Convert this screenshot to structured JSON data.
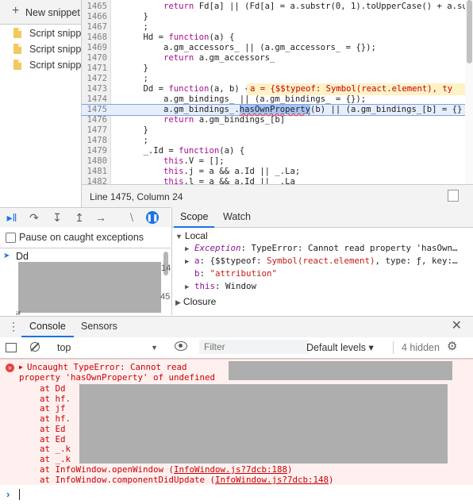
{
  "sources_sidebar": {
    "new_snippet_label": "New snippet",
    "snippets": [
      "Script snipp",
      "Script snipp",
      "Script snipp"
    ]
  },
  "editor": {
    "lines": [
      {
        "num": "1465",
        "code": "        return Fd[a] || (Fd[a] = a.substr(0, 1).toUpperCase() + a.su"
      },
      {
        "num": "1466",
        "code": "    }"
      },
      {
        "num": "1467",
        "code": "    ;"
      },
      {
        "num": "1468",
        "code": "    Hd = function(a) {"
      },
      {
        "num": "1469",
        "code": "        a.gm_accessors_ || (a.gm_accessors_ = {});"
      },
      {
        "num": "1470",
        "code": "        return a.gm_accessors_"
      },
      {
        "num": "1471",
        "code": "    }"
      },
      {
        "num": "1472",
        "code": "    ;"
      },
      {
        "num": "1473",
        "code": "    Dd = function(a, b) {"
      },
      {
        "num": "1474",
        "code": "        a.gm_bindings_ || (a.gm_bindings_ = {});"
      },
      {
        "num": "1475",
        "code": "        a.gm_bindings_.hasOwnProperty(b) || (a.gm_bindings_[b] = {}"
      },
      {
        "num": "1476",
        "code": "        return a.gm_bindings_[b]"
      },
      {
        "num": "1477",
        "code": "    }"
      },
      {
        "num": "1478",
        "code": "    ;"
      },
      {
        "num": "1479",
        "code": "    _.Id = function(a) {"
      },
      {
        "num": "1480",
        "code": "        this.V = [];"
      },
      {
        "num": "1481",
        "code": "        this.j = a && a.Id || _.La;"
      },
      {
        "num": "1482",
        "code": "        this.l = a && a.Id || _.La"
      }
    ],
    "inline_tooltip": "a = {$$typeof: Symbol(react.element), ty",
    "status": "Line 1475, Column 24"
  },
  "debugger": {
    "pause_on_caught_label": "Pause on caught exceptions",
    "call_stack_first": "Dd",
    "call_stack_num_1": "14",
    "call_stack_num_2": "45",
    "call_stack_if": "if"
  },
  "scope": {
    "tabs": [
      "Scope",
      "Watch"
    ],
    "local_label": "Local",
    "exception_key": "Exception",
    "exception_val": "TypeError: Cannot read property 'hasOwn…",
    "a_key": "a",
    "a_val_pre": "{$$typeof: ",
    "a_val_sym": "Symbol(react.element)",
    "a_val_post": ", type: ƒ, key:…",
    "b_key": "b",
    "b_val": "\"attribution\"",
    "this_key": "this",
    "this_val": "Window",
    "closure_label": "Closure"
  },
  "drawer": {
    "tabs": [
      "Console",
      "Sensors"
    ],
    "context": "top",
    "filter_placeholder": "Filter",
    "levels": "Default levels ▾",
    "hidden_count": "4 hidden"
  },
  "console_error": {
    "line1": "Uncaught TypeError: Cannot read",
    "line2": "property 'hasOwnProperty' of undefined",
    "stack": [
      "at Dd",
      "at hf.",
      "at jf",
      "at hf.",
      "at Ed",
      "at Ed",
      "at _.k",
      "at _.k"
    ],
    "frame_open_pre": "at InfoWindow.",
    "frame_open_fn": "openWindow (",
    "frame_open_link": "InfoWindow.js?7dcb:188",
    "frame_update_pre": "at InfoWindow.componentDidUpdate (",
    "frame_update_link": "InfoWindow.js?7dcb:148",
    "close_paren": ")"
  }
}
